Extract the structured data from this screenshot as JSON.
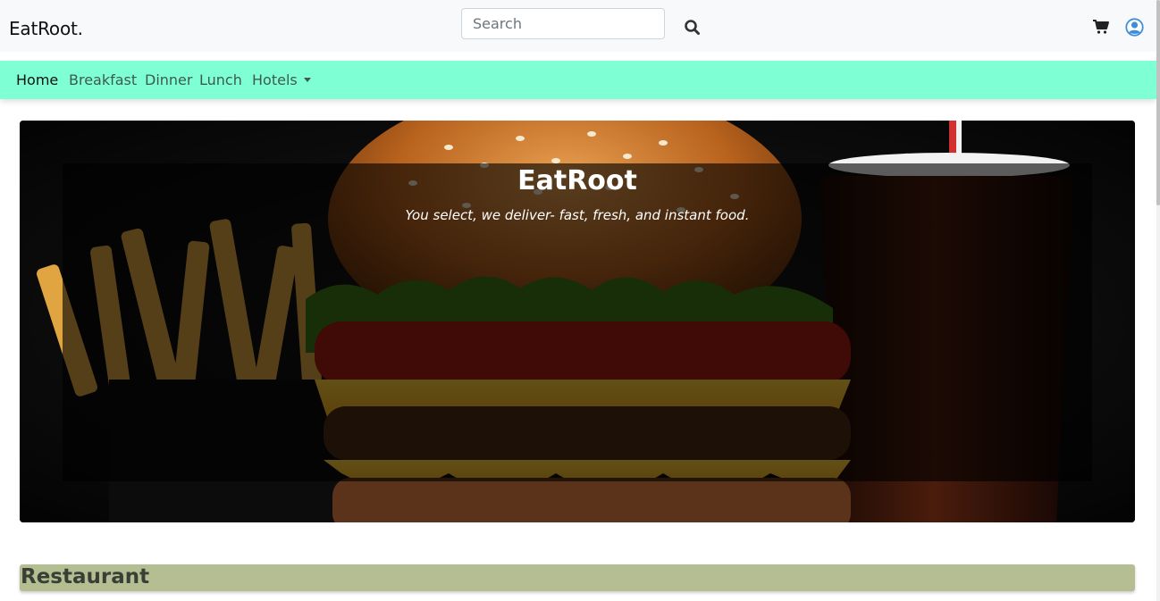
{
  "header": {
    "brand": "EatRoot.",
    "search": {
      "placeholder": "Search",
      "value": ""
    },
    "icons": [
      "search-icon",
      "cart-icon",
      "user-icon"
    ]
  },
  "nav": {
    "items": [
      {
        "label": "Home",
        "active": true
      },
      {
        "label": "Breakfast"
      },
      {
        "label": "Dinner"
      },
      {
        "label": "Lunch"
      },
      {
        "label": "Hotels",
        "dropdown": true
      }
    ]
  },
  "hero": {
    "title": "EatRoot",
    "subtitle": "You select, we deliver- fast, fresh, and instant food."
  },
  "section": {
    "title": "Restaurant"
  },
  "colors": {
    "navbar_bg": "#7fffd4",
    "section_bg": "#b5be93",
    "header_bg": "#f8f9fa",
    "user_icon": "#3f8fd8"
  }
}
